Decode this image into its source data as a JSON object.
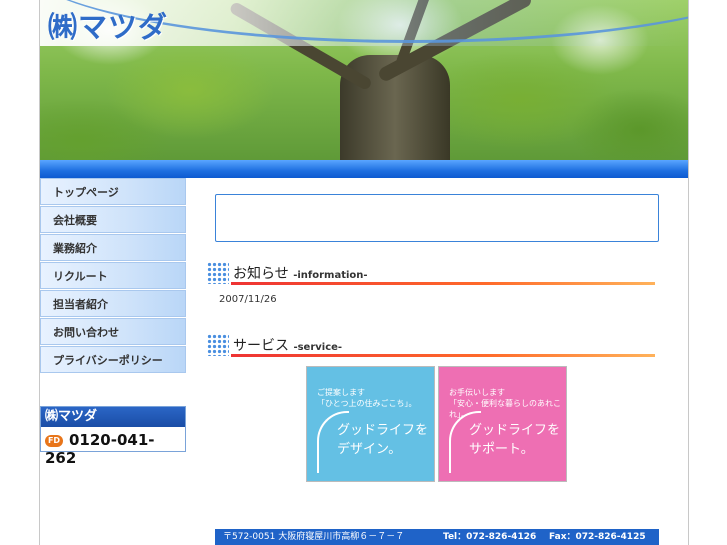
{
  "header": {
    "logo_text": "㈱マツダ"
  },
  "sidebar": {
    "items": [
      {
        "label": "トップページ"
      },
      {
        "label": "会社概要"
      },
      {
        "label": "業務紹介"
      },
      {
        "label": "リクルート"
      },
      {
        "label": "担当者紹介"
      },
      {
        "label": "お問い合わせ"
      },
      {
        "label": "プライバシーポリシー"
      }
    ],
    "contact": {
      "company": "㈱マツダ",
      "free_dial_label": "FD",
      "phone": "0120-041-262"
    }
  },
  "information": {
    "title": "お知らせ",
    "subtitle": "-information-",
    "date": "2007/11/26"
  },
  "service": {
    "title": "サービス",
    "subtitle": "-service-",
    "banners": [
      {
        "small_line1": "ご提案します",
        "small_line2": "「ひとつ上の住みごこち」。",
        "big_line1": "グッドライフを",
        "big_line2": "デザイン。",
        "color": "#64c0e4"
      },
      {
        "small_line1": "お手伝いします",
        "small_line2": "「安心・便利な暮らしのあれこれ」。",
        "big_line1": "グッドライフを",
        "big_line2": "サポート。",
        "color": "#ee6fb3"
      }
    ]
  },
  "footer": {
    "address": "〒572-0051 大阪府寝屋川市高柳６－７－７",
    "tel": "Tel：072-826-4126",
    "fax": "Fax：072-826-4125"
  },
  "colors": {
    "accent_blue": "#1f63c8",
    "line_red": "#e33333",
    "design_blue": "#64c0e4",
    "support_pink": "#ee6fb3"
  }
}
